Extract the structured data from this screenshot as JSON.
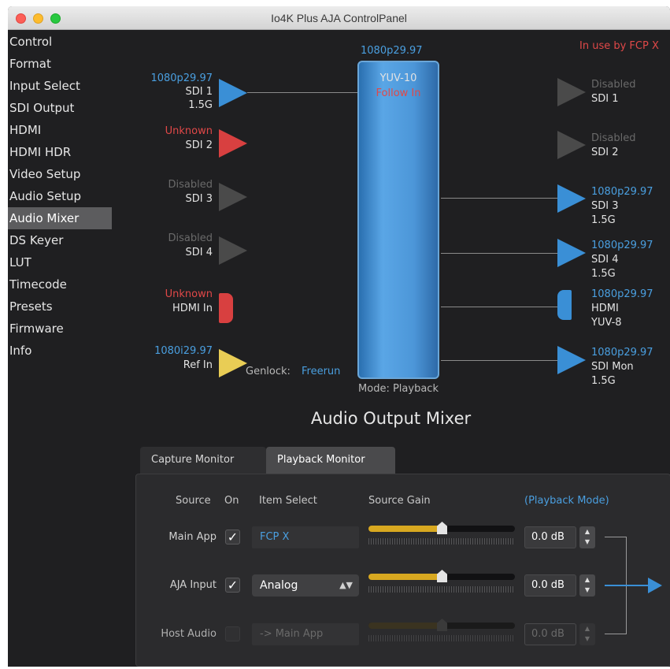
{
  "window": {
    "title": "Io4K Plus AJA ControlPanel"
  },
  "sidebar": {
    "items": [
      {
        "label": "Control"
      },
      {
        "label": "Format"
      },
      {
        "label": "Input Select"
      },
      {
        "label": "SDI Output"
      },
      {
        "label": "HDMI"
      },
      {
        "label": "HDMI HDR"
      },
      {
        "label": "Video Setup"
      },
      {
        "label": "Audio Setup"
      },
      {
        "label": "Audio Mixer"
      },
      {
        "label": "DS Keyer"
      },
      {
        "label": "LUT"
      },
      {
        "label": "Timecode"
      },
      {
        "label": "Presets"
      },
      {
        "label": "Firmware"
      },
      {
        "label": "Info"
      }
    ],
    "active": "Audio Mixer"
  },
  "status": {
    "in_use": "In use by FCP X"
  },
  "core": {
    "format": "1080p29.97",
    "colorspace": "YUV-10",
    "mode": "Follow In",
    "footer": "Mode: Playback"
  },
  "genlock": {
    "label": "Genlock:",
    "value": "Freerun"
  },
  "inputs": [
    {
      "format": "1080p29.97",
      "name": "SDI 1",
      "rate": "1.5G"
    },
    {
      "format": "Unknown",
      "name": "SDI 2"
    },
    {
      "format": "Disabled",
      "name": "SDI 3"
    },
    {
      "format": "Disabled",
      "name": "SDI 4"
    },
    {
      "format": "Unknown",
      "name": "HDMI In"
    },
    {
      "format": "1080i29.97",
      "name": "Ref In"
    }
  ],
  "outputs": [
    {
      "format": "Disabled",
      "name": "SDI 1"
    },
    {
      "format": "Disabled",
      "name": "SDI 2"
    },
    {
      "format": "1080p29.97",
      "name": "SDI 3",
      "rate": "1.5G"
    },
    {
      "format": "1080p29.97",
      "name": "SDI 4",
      "rate": "1.5G"
    },
    {
      "format": "1080p29.97",
      "name": "HDMI",
      "rate": "YUV-8"
    },
    {
      "format": "1080p29.97",
      "name": "SDI Mon",
      "rate": "1.5G"
    }
  ],
  "mixer": {
    "title": "Audio Output Mixer",
    "tabs": [
      {
        "label": "Capture Monitor"
      },
      {
        "label": "Playback Monitor"
      }
    ],
    "active_tab": "Playback Monitor",
    "headers": {
      "source": "Source",
      "on": "On",
      "item_select": "Item Select",
      "source_gain": "Source Gain",
      "mode": "(Playback Mode)"
    },
    "rows": [
      {
        "source": "Main App",
        "on": true,
        "item": "FCP X",
        "gain": "0.0 dB",
        "level": 0.5
      },
      {
        "source": "AJA Input",
        "on": true,
        "item": "Analog",
        "gain": "0.0 dB",
        "level": 0.5
      },
      {
        "source": "Host Audio",
        "on": false,
        "item": "-> Main App",
        "gain": "0.0 dB",
        "level": 0.5
      }
    ],
    "check_glyph": "✓",
    "select_arrows": "▲▼",
    "stepper_up": "▲",
    "stepper_down": "▼"
  },
  "colors": {
    "accent_blue": "#3a8fd6",
    "error_red": "#d84040",
    "ref_yellow": "#e9cd55",
    "gain_fill": "#d8a820"
  }
}
